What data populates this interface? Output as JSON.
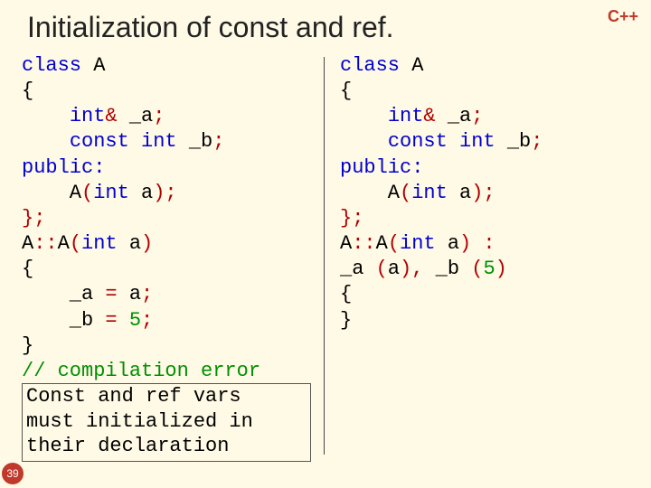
{
  "badge": "C++",
  "title": "Initialization of const and ref.",
  "page_number": "39",
  "left": {
    "l1": "class ",
    "l1b": "A",
    "l2": "{",
    "l3a": "    ",
    "l3b": "int",
    "l3c": "& ",
    "l3d": "_a",
    "l3e": ";",
    "l4a": "    ",
    "l4b": "const int ",
    "l4c": "_b",
    "l4d": ";",
    "l5": "public:",
    "l6a": "    A",
    "l6b": "(",
    "l6c": "int ",
    "l6d": "a",
    "l6e": ");",
    "l7": "};",
    "l8a": "A",
    "l8b": "::",
    "l8c": "A",
    "l8d": "(",
    "l8e": "int ",
    "l8f": "a",
    "l8g": ")",
    "l9": "{",
    "l10a": "    _a ",
    "l10b": "= ",
    "l10c": "a",
    "l10d": ";",
    "l11a": "    _b ",
    "l11b": "= ",
    "l11c": "5",
    "l11d": ";",
    "l12": "}",
    "l13": "// compilation error",
    "err1": "Const and ref vars",
    "err2": "must initialized in",
    "err3": "their declaration"
  },
  "right": {
    "l1": "class ",
    "l1b": "A",
    "l2": "{",
    "l3a": "    ",
    "l3b": "int",
    "l3c": "& ",
    "l3d": "_a",
    "l3e": ";",
    "l4a": "    ",
    "l4b": "const int ",
    "l4c": "_b",
    "l4d": ";",
    "l5": "public:",
    "l6a": "    A",
    "l6b": "(",
    "l6c": "int ",
    "l6d": "a",
    "l6e": ");",
    "l7": "};",
    "l8a": "A",
    "l8b": "::",
    "l8c": "A",
    "l8d": "(",
    "l8e": "int ",
    "l8f": "a",
    "l8g": ") :",
    "l9a": "_a ",
    "l9b": "(",
    "l9c": "a",
    "l9d": "), ",
    "l9e": "_b ",
    "l9f": "(",
    "l9g": "5",
    "l9h": ")",
    "l10": "{",
    "l11": "}"
  }
}
